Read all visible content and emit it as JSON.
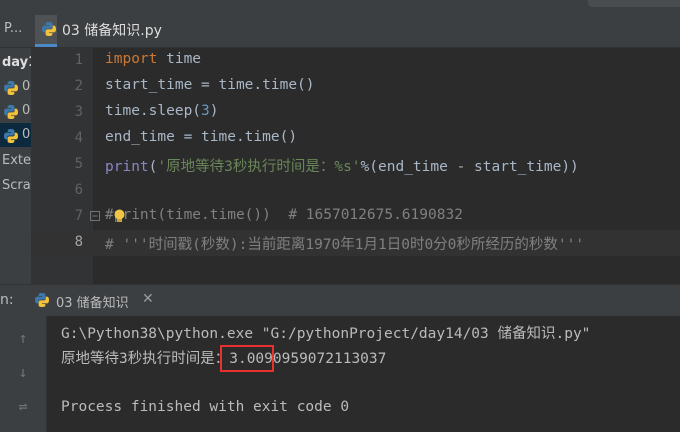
{
  "project": {
    "header": "P...",
    "rows": [
      {
        "label": "day1"
      },
      {
        "label": "0"
      },
      {
        "label": "0"
      },
      {
        "label": "0"
      },
      {
        "label": "Exte"
      },
      {
        "label": "Scra"
      }
    ]
  },
  "editor": {
    "tab_label": "03 储备知识.py",
    "line_numbers": [
      "1",
      "2",
      "3",
      "4",
      "5",
      "6",
      "7",
      "8"
    ],
    "lines": {
      "l1_kw": "import",
      "l1_rest": " time",
      "l2": "start_time = time.time()",
      "l3_a": "time.sleep(",
      "l3_num": "3",
      "l3_b": ")",
      "l4": "end_time = time.time()",
      "l5_fn": "print",
      "l5_a": "(",
      "l5_str": "'原地等待3秒执行时间是：%s'",
      "l5_b": "%(end_time - start_time))",
      "l7": "#print(time.time())  # 1657012675.6190832",
      "l8": "# '''时间戳(秒数):当前距离1970年1月1日0时0分0秒所经历的秒数'''"
    }
  },
  "run": {
    "label": "n:",
    "tab_label": "03 储备知识",
    "output": [
      "G:\\Python38\\python.exe \"G:/pythonProject/day14/03 储备知识.py\"",
      "原地等待3秒执行时间是：3.0090959072113037",
      "",
      "Process finished with exit code 0"
    ]
  },
  "colors": {
    "keyword": "#cc7832",
    "builtin": "#8888c6",
    "string": "#6a8759",
    "number": "#6897bb",
    "comment": "#808080",
    "highlight_box": "#e5322d"
  },
  "icons": [
    "python-file-icon",
    "lightbulb-icon",
    "fold-icon",
    "close-icon",
    "rerun-icon",
    "scroll-icon"
  ]
}
